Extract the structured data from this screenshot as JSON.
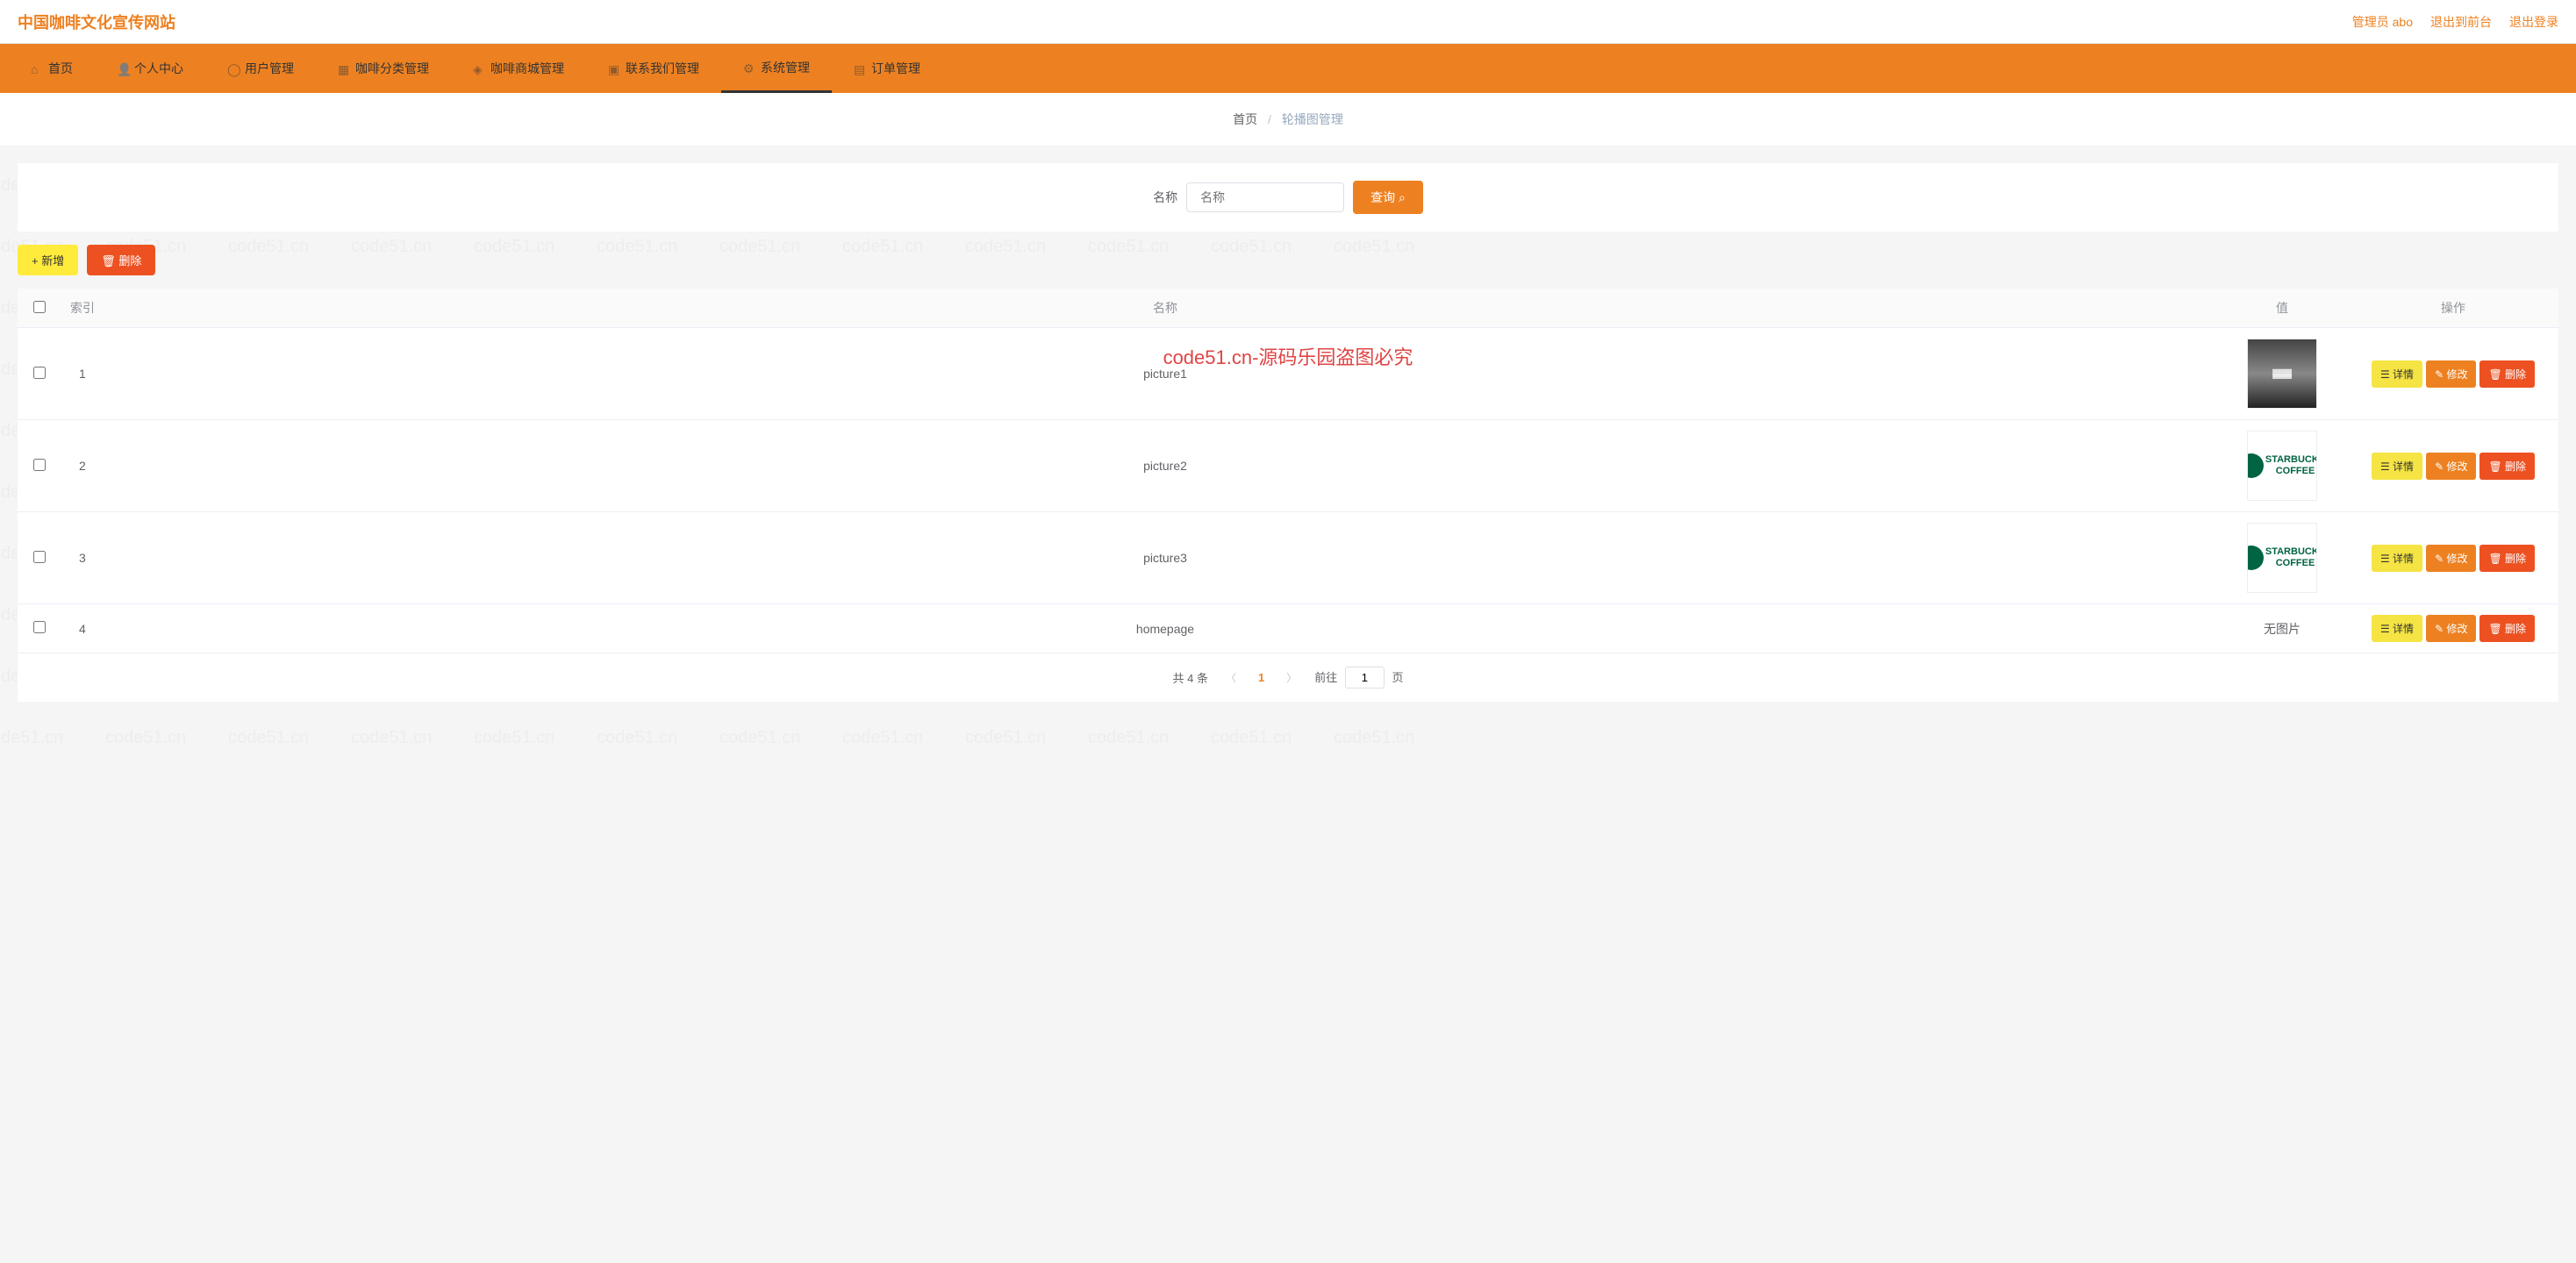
{
  "header": {
    "site_title": "中国咖啡文化宣传网站",
    "admin_label": "管理员 abo",
    "to_front": "退出到前台",
    "logout": "退出登录"
  },
  "nav": {
    "items": [
      {
        "label": "首页"
      },
      {
        "label": "个人中心"
      },
      {
        "label": "用户管理"
      },
      {
        "label": "咖啡分类管理"
      },
      {
        "label": "咖啡商城管理"
      },
      {
        "label": "联系我们管理"
      },
      {
        "label": "系统管理"
      },
      {
        "label": "订单管理"
      }
    ]
  },
  "breadcrumb": {
    "home": "首页",
    "current": "轮播图管理"
  },
  "search": {
    "label": "名称",
    "placeholder": "名称",
    "button": "查询 "
  },
  "actions": {
    "add": "新增",
    "delete": "删除"
  },
  "table": {
    "headers": {
      "index": "索引",
      "name": "名称",
      "value": "值",
      "ops": "操作"
    },
    "rows": [
      {
        "index": "1",
        "name": "picture1",
        "image": "thumb1",
        "no_image": false
      },
      {
        "index": "2",
        "name": "picture2",
        "image": "starbucks",
        "no_image": false
      },
      {
        "index": "3",
        "name": "picture3",
        "image": "starbucks",
        "no_image": false
      },
      {
        "index": "4",
        "name": "homepage",
        "image": "",
        "no_image": true
      }
    ],
    "no_image_text": "无图片",
    "btn_detail": "详情",
    "btn_edit": "修改",
    "btn_delete": "删除"
  },
  "pagination": {
    "total": "共 4 条",
    "current": "1",
    "goto_prefix": "前往",
    "goto_value": "1",
    "goto_suffix": "页"
  },
  "watermark": {
    "bg": "code51.cn",
    "center": "code51.cn-源码乐园盗图必究"
  }
}
